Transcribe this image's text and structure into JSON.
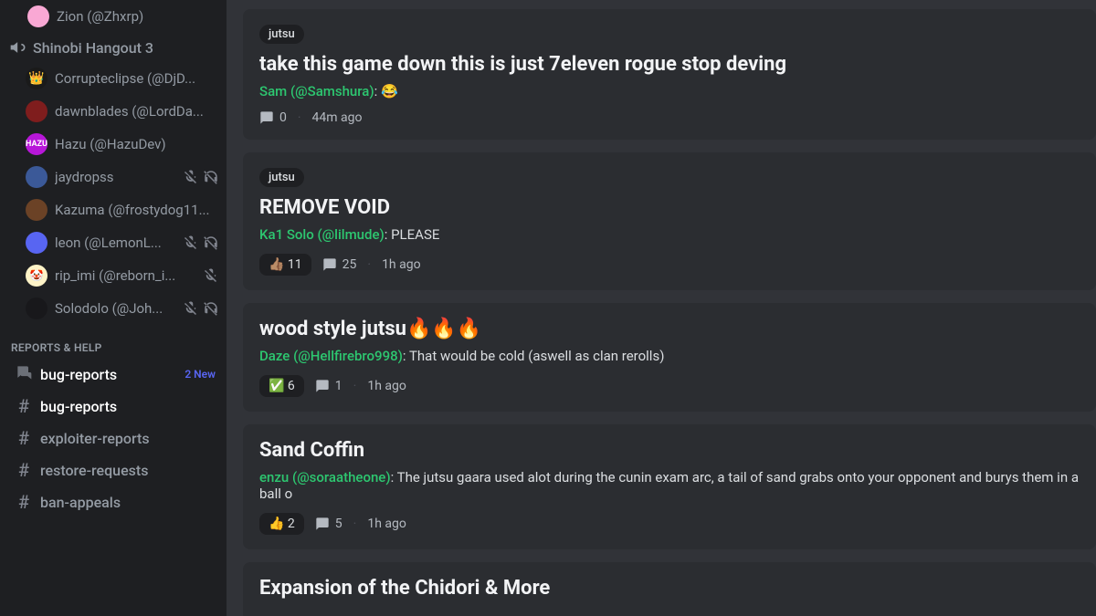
{
  "sidebar": {
    "top_member": {
      "label": "Zion (@Zhxrp)"
    },
    "voice_channel": "Shinobi Hangout 3",
    "members": [
      {
        "label": "Corrupteclipse (@DjD...",
        "av": "av-crown",
        "emoji": "👑",
        "muted": false,
        "deaf": false
      },
      {
        "label": "dawnblades (@LordDa...",
        "av": "av-red",
        "emoji": "",
        "muted": false,
        "deaf": false
      },
      {
        "label": "Hazu (@HazuDev)",
        "av": "av-hazu",
        "emoji": "HAZU",
        "muted": false,
        "deaf": false
      },
      {
        "label": "jaydropss",
        "av": "av-blue",
        "emoji": "",
        "muted": true,
        "deaf": true
      },
      {
        "label": "Kazuma (@frostydog11...",
        "av": "av-brown",
        "emoji": "",
        "muted": false,
        "deaf": false
      },
      {
        "label": "leon (@LemonL...",
        "av": "av-discord",
        "emoji": "",
        "muted": true,
        "deaf": true
      },
      {
        "label": "rip_imi (@reborn_i...",
        "av": "av-clown",
        "emoji": "🤡",
        "muted": true,
        "deaf": false
      },
      {
        "label": "Solodolo (@Joh...",
        "av": "av-dark",
        "emoji": "",
        "muted": true,
        "deaf": true
      }
    ],
    "category": "REPORTS & HELP",
    "channels": [
      {
        "type": "forum",
        "name": "bug-reports",
        "unread": true,
        "badge": "2 New"
      },
      {
        "type": "text",
        "name": "bug-reports",
        "unread": true
      },
      {
        "type": "text",
        "name": "exploiter-reports",
        "unread": false
      },
      {
        "type": "text",
        "name": "restore-requests",
        "unread": false
      },
      {
        "type": "text",
        "name": "ban-appeals",
        "unread": false
      }
    ]
  },
  "posts": [
    {
      "tag": "jutsu",
      "title": "take this game down this is just 7eleven rogue stop deving",
      "author": "Sam (@Samshura)",
      "body": ": 😂",
      "reactions": [],
      "replies": "0",
      "time": "44m ago"
    },
    {
      "tag": "jutsu",
      "title": "REMOVE VOID",
      "author": "Ka1 Solo (@lilmude)",
      "body": ": PLEASE",
      "reactions": [
        {
          "emoji": "👍🏽",
          "count": "11"
        }
      ],
      "replies": "25",
      "time": "1h ago"
    },
    {
      "tag": "",
      "title": "wood style jutsu🔥🔥🔥",
      "author": "Daze (@Hellfirebro998)",
      "body": ": That would be cold (aswell as clan rerolls)",
      "reactions": [
        {
          "emoji": "✅",
          "count": "6"
        }
      ],
      "replies": "1",
      "time": "1h ago"
    },
    {
      "tag": "",
      "title": "Sand Coffin",
      "author": "enzu (@soraatheone)",
      "body": ": The jutsu gaara used alot during the cunin exam arc, a tail of sand grabs onto your opponent and burys them in a ball o",
      "reactions": [
        {
          "emoji": "👍",
          "count": "2"
        }
      ],
      "replies": "5",
      "time": "1h ago"
    },
    {
      "tag": "",
      "title": "Expansion of the Chidori & More",
      "author": "",
      "body": "",
      "reactions": [],
      "replies": "",
      "time": ""
    }
  ]
}
